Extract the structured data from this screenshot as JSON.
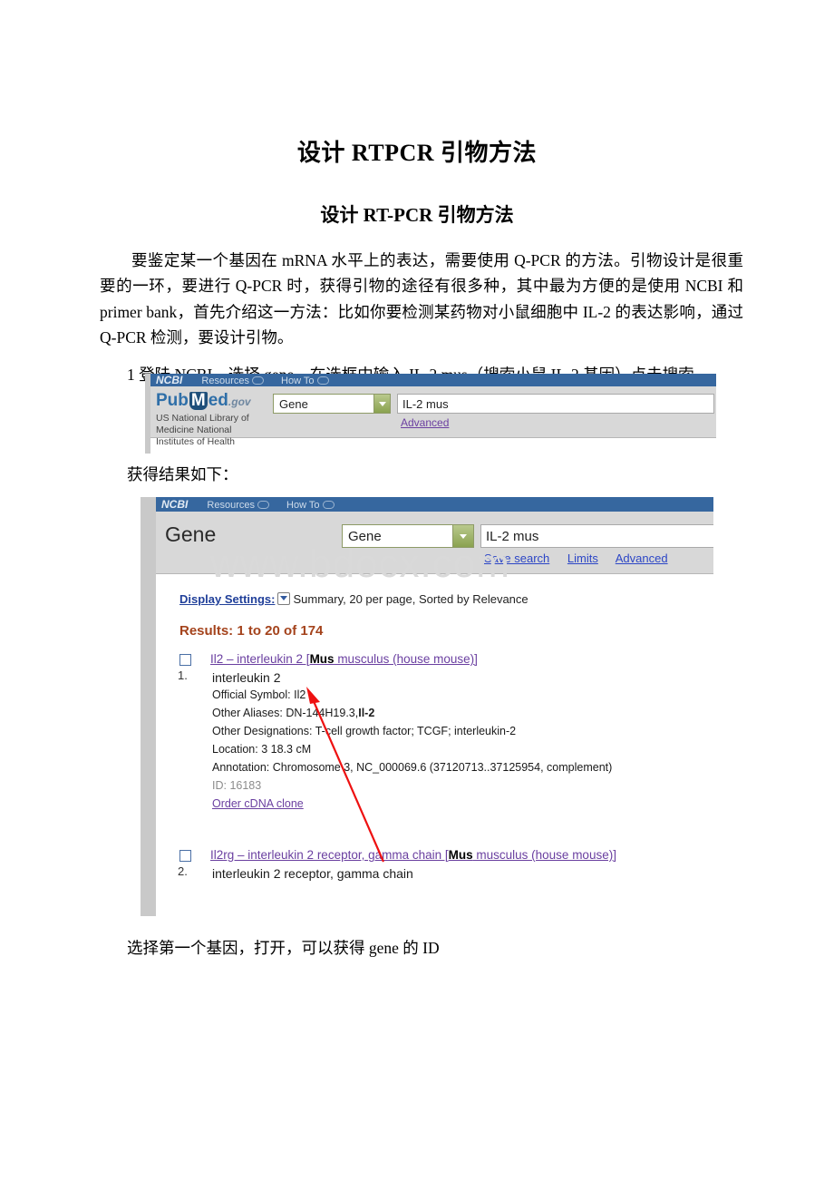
{
  "document": {
    "title": "设计 RTPCR 引物方法",
    "subtitle": "设计 RT-PCR 引物方法",
    "paragraph": "要鉴定某一个基因在 mRNA 水平上的表达，需要使用 Q-PCR 的方法。引物设计是很重要的一环，要进行 Q-PCR 时，获得引物的途径有很多种，其中最为方便的是使用 NCBI 和 primer bank，首先介绍这一方法：比如你要检测某药物对小鼠细胞中 IL-2 的表达影响，通过 Q-PCR 检测，要设计引物。",
    "step1": "1 登陆 NCBI，选择 gene，在选框中输入 IL-2 mus（搜索小鼠 IL-2 基因）点击搜索",
    "caption_results": "获得结果如下：",
    "caption_footer": "选择第一个基因，打开，可以获得 gene 的 ID"
  },
  "watermark": "www.bdocx.com",
  "screenshot1": {
    "topbar": {
      "logo": "NCBI",
      "resources": "Resources",
      "howto": "How To"
    },
    "logo": {
      "pub": "Pub",
      "m": "M",
      "ed": "ed",
      "gov": ".gov",
      "subtitle": "US National Library of Medicine National Institutes of Health"
    },
    "db_select": "Gene",
    "query": "IL-2 mus",
    "links": [
      "Advanced"
    ]
  },
  "screenshot2": {
    "topbar": {
      "logo": "NCBI",
      "resources": "Resources",
      "howto": "How To"
    },
    "page_title": "Gene",
    "db_select": "Gene",
    "query": "IL-2 mus",
    "links": [
      "Save search",
      "Limits",
      "Advanced"
    ],
    "display_settings": {
      "link": "Display Settings:",
      "summary": "Summary, 20 per page, Sorted by Relevance"
    },
    "results_header": "Results: 1 to 20 of 174",
    "results": [
      {
        "num": "1.",
        "title_plain_a": "Il2 – interleukin 2 [",
        "title_bold": "Mus",
        "title_plain_b": " musculus (house mouse)]",
        "name": "interleukin 2",
        "fields": [
          {
            "label": "Official Symbol:",
            "value": "Il2"
          },
          {
            "label": "Other Aliases:",
            "value": "DN-144H19.3,",
            "value_bold": "Il-2"
          },
          {
            "label": "Other Designations:",
            "value": "T-cell growth factor; TCGF; interleukin-2"
          },
          {
            "label": "Location:",
            "value": "3 18.3 cM"
          },
          {
            "label": "Annotation:",
            "value": "Chromosome 3, NC_000069.6 (37120713..37125954, complement)"
          }
        ],
        "id": "ID: 16183",
        "order_link": "Order cDNA clone"
      },
      {
        "num": "2.",
        "title_plain_a": "Il2rg – interleukin 2 receptor, gamma chain [",
        "title_bold": "Mus",
        "title_plain_b": " musculus (house mouse)]",
        "name": "interleukin 2 receptor, gamma chain"
      }
    ]
  },
  "colors": {
    "ncbi_blue": "#36679f",
    "band_gray": "#d8d8d8",
    "select_green": "#8aa24f",
    "link_blue": "#21409a",
    "link_violet": "#6a3fa0",
    "results_orange": "#a4431c",
    "arrow_red": "#ee1111"
  }
}
